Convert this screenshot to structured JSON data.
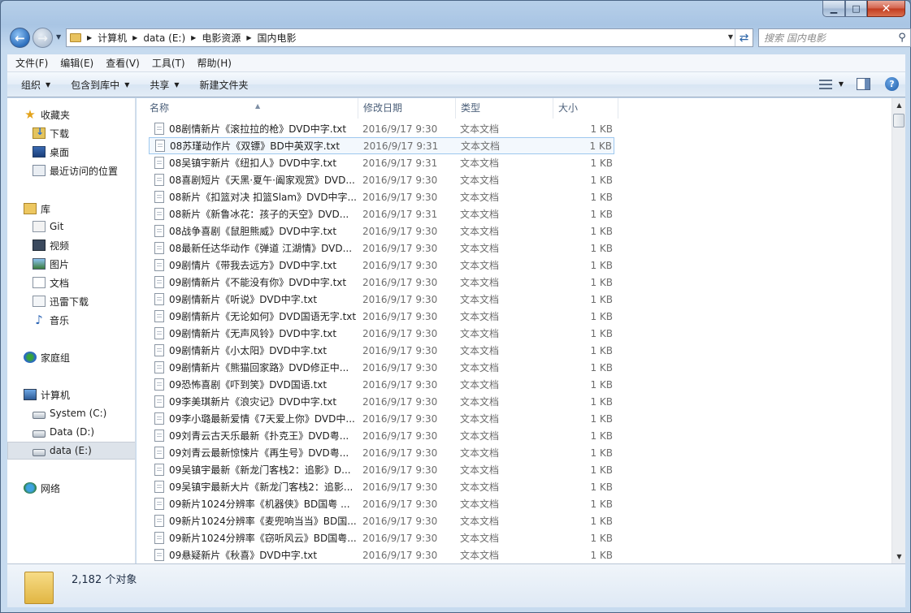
{
  "window": {
    "minimize_glyph": "▁",
    "maximize_glyph": "□",
    "close_glyph": "✕"
  },
  "address": {
    "breadcrumbs": [
      "计算机",
      "data (E:)",
      "电影资源",
      "国内电影"
    ]
  },
  "search": {
    "placeholder": "搜索 国内电影"
  },
  "menu": [
    "文件(F)",
    "编辑(E)",
    "查看(V)",
    "工具(T)",
    "帮助(H)"
  ],
  "commands": {
    "organize": "组织",
    "include": "包含到库中",
    "share": "共享",
    "new_folder": "新建文件夹"
  },
  "nav": {
    "favorites": "收藏夹",
    "downloads": "下载",
    "desktop": "桌面",
    "recent": "最近访问的位置",
    "libraries": "库",
    "git": "Git",
    "videos": "视频",
    "pictures": "图片",
    "documents": "文档",
    "thunder": "迅雷下载",
    "music": "音乐",
    "homegroup": "家庭组",
    "computer": "计算机",
    "system_c": "System (C:)",
    "data_d": "Data (D:)",
    "data_e": "data (E:)",
    "network": "网络"
  },
  "columns": {
    "name": "名称",
    "date": "修改日期",
    "type": "类型",
    "size": "大小"
  },
  "files": [
    {
      "name": "08剧情新片《滚拉拉的枪》DVD中字.txt",
      "date": "2016/9/17 9:30",
      "type": "文本文档",
      "size": "1 KB"
    },
    {
      "name": "08苏瑾动作片《双镖》BD中英双字.txt",
      "date": "2016/9/17 9:31",
      "type": "文本文档",
      "size": "1 KB"
    },
    {
      "name": "08吴镇宇新片《纽扣人》DVD中字.txt",
      "date": "2016/9/17 9:31",
      "type": "文本文档",
      "size": "1 KB"
    },
    {
      "name": "08喜剧短片《天黑·夏午·阖家观赏》DVD...",
      "date": "2016/9/17 9:30",
      "type": "文本文档",
      "size": "1 KB"
    },
    {
      "name": "08新片《扣篮对决 扣篮Slam》DVD中字...",
      "date": "2016/9/17 9:30",
      "type": "文本文档",
      "size": "1 KB"
    },
    {
      "name": "08新片《新鲁冰花：孩子的天空》DVD...",
      "date": "2016/9/17 9:31",
      "type": "文本文档",
      "size": "1 KB"
    },
    {
      "name": "08战争喜剧《鼠胆熊威》DVD中字.txt",
      "date": "2016/9/17 9:30",
      "type": "文本文档",
      "size": "1 KB"
    },
    {
      "name": "08最新任达华动作《弹道 江湖情》DVD...",
      "date": "2016/9/17 9:30",
      "type": "文本文档",
      "size": "1 KB"
    },
    {
      "name": "09剧情片《带我去远方》DVD中字.txt",
      "date": "2016/9/17 9:30",
      "type": "文本文档",
      "size": "1 KB"
    },
    {
      "name": "09剧情新片《不能没有你》DVD中字.txt",
      "date": "2016/9/17 9:30",
      "type": "文本文档",
      "size": "1 KB"
    },
    {
      "name": "09剧情新片《听说》DVD中字.txt",
      "date": "2016/9/17 9:30",
      "type": "文本文档",
      "size": "1 KB"
    },
    {
      "name": "09剧情新片《无论如何》DVD国语无字.txt",
      "date": "2016/9/17 9:30",
      "type": "文本文档",
      "size": "1 KB"
    },
    {
      "name": "09剧情新片《无声风铃》DVD中字.txt",
      "date": "2016/9/17 9:30",
      "type": "文本文档",
      "size": "1 KB"
    },
    {
      "name": "09剧情新片《小太阳》DVD中字.txt",
      "date": "2016/9/17 9:30",
      "type": "文本文档",
      "size": "1 KB"
    },
    {
      "name": "09剧情新片《熊猫回家路》DVD修正中...",
      "date": "2016/9/17 9:30",
      "type": "文本文档",
      "size": "1 KB"
    },
    {
      "name": "09恐怖喜剧《吓到笑》DVD国语.txt",
      "date": "2016/9/17 9:30",
      "type": "文本文档",
      "size": "1 KB"
    },
    {
      "name": "09李美琪新片《浪灾记》DVD中字.txt",
      "date": "2016/9/17 9:30",
      "type": "文本文档",
      "size": "1 KB"
    },
    {
      "name": "09李小璐最新爱情《7天爱上你》DVD中...",
      "date": "2016/9/17 9:30",
      "type": "文本文档",
      "size": "1 KB"
    },
    {
      "name": "09刘青云古天乐最新《扑克王》DVD粤...",
      "date": "2016/9/17 9:30",
      "type": "文本文档",
      "size": "1 KB"
    },
    {
      "name": "09刘青云最新惊悚片《再生号》DVD粤...",
      "date": "2016/9/17 9:30",
      "type": "文本文档",
      "size": "1 KB"
    },
    {
      "name": "09吴镇宇最新《新龙门客栈2：追影》D...",
      "date": "2016/9/17 9:30",
      "type": "文本文档",
      "size": "1 KB"
    },
    {
      "name": "09吴镇宇最新大片《新龙门客栈2：追影...",
      "date": "2016/9/17 9:30",
      "type": "文本文档",
      "size": "1 KB"
    },
    {
      "name": "09新片1024分辨率《机器侠》BD国粤 ...",
      "date": "2016/9/17 9:30",
      "type": "文本文档",
      "size": "1 KB"
    },
    {
      "name": "09新片1024分辨率《麦兜响当当》BD国...",
      "date": "2016/9/17 9:30",
      "type": "文本文档",
      "size": "1 KB"
    },
    {
      "name": "09新片1024分辨率《窃听风云》BD国粤...",
      "date": "2016/9/17 9:30",
      "type": "文本文档",
      "size": "1 KB"
    },
    {
      "name": "09悬疑新片《秋喜》DVD中字.txt",
      "date": "2016/9/17 9:30",
      "type": "文本文档",
      "size": "1 KB"
    }
  ],
  "status": {
    "count": "2,182 个对象"
  }
}
